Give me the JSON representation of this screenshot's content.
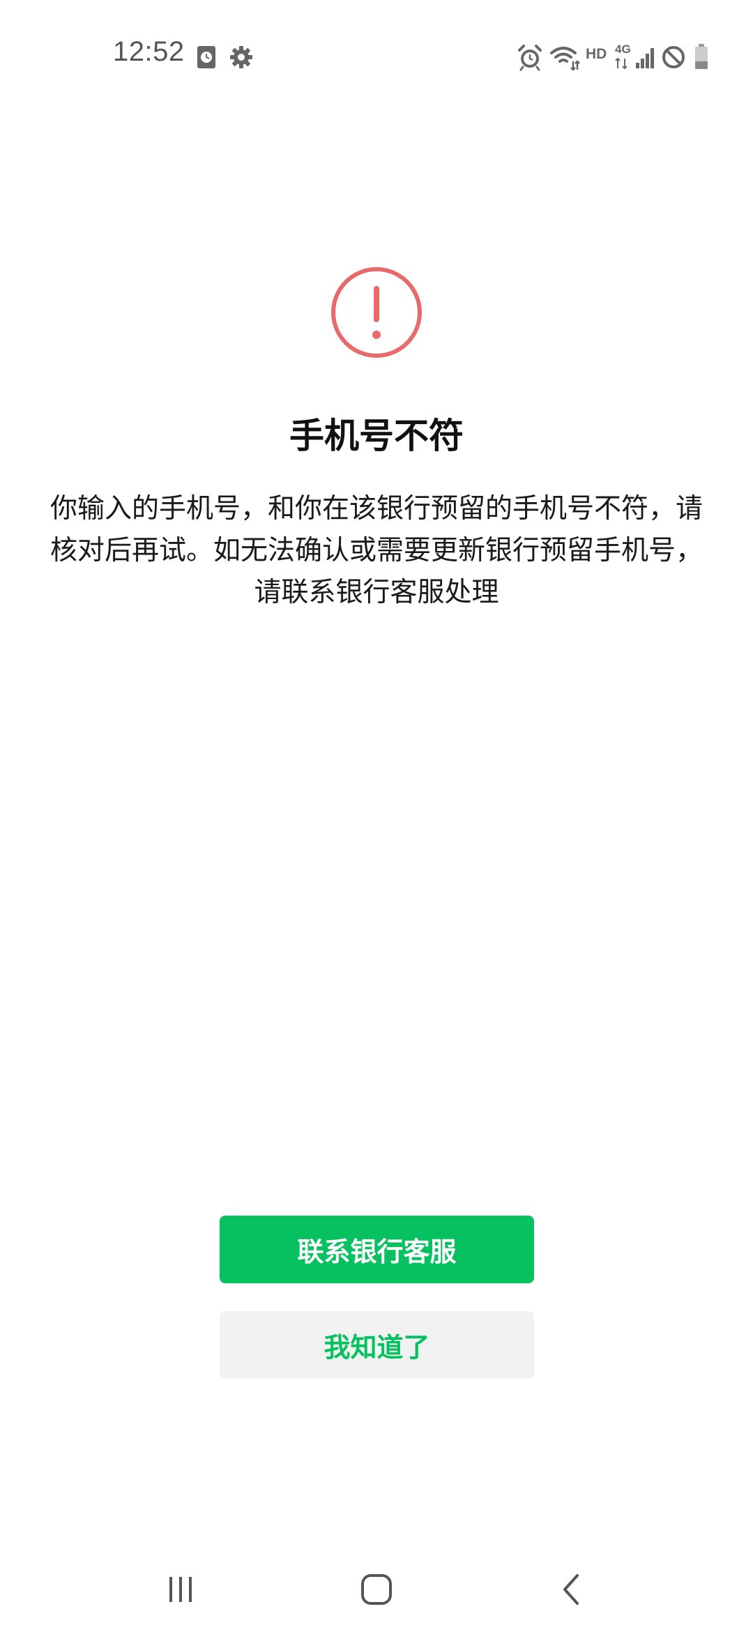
{
  "status_bar": {
    "time": "12:52",
    "left_icons": [
      "calendar-clock-icon",
      "settings-gear-icon"
    ],
    "right_icons": [
      "alarm-icon",
      "wifi-icon",
      "hd-icon",
      "4g-icon",
      "signal-icon",
      "do-not-disturb-icon",
      "battery-icon"
    ],
    "hd_label": "HD",
    "network_label": "4G"
  },
  "dialog": {
    "icon": "exclamation-circle-icon",
    "icon_color": "#e96a6a",
    "title": "手机号不符",
    "message": "你输入的手机号，和你在该银行预留的手机号不符，请核对后再试。如无法确认或需要更新银行预留手机号，请联系银行客服处理"
  },
  "buttons": {
    "primary_label": "联系银行客服",
    "secondary_label": "我知道了",
    "primary_color": "#07c160",
    "secondary_bg": "#f2f2f2"
  },
  "nav_bar": {
    "items": [
      "recent-apps-icon",
      "home-icon",
      "back-icon"
    ]
  }
}
